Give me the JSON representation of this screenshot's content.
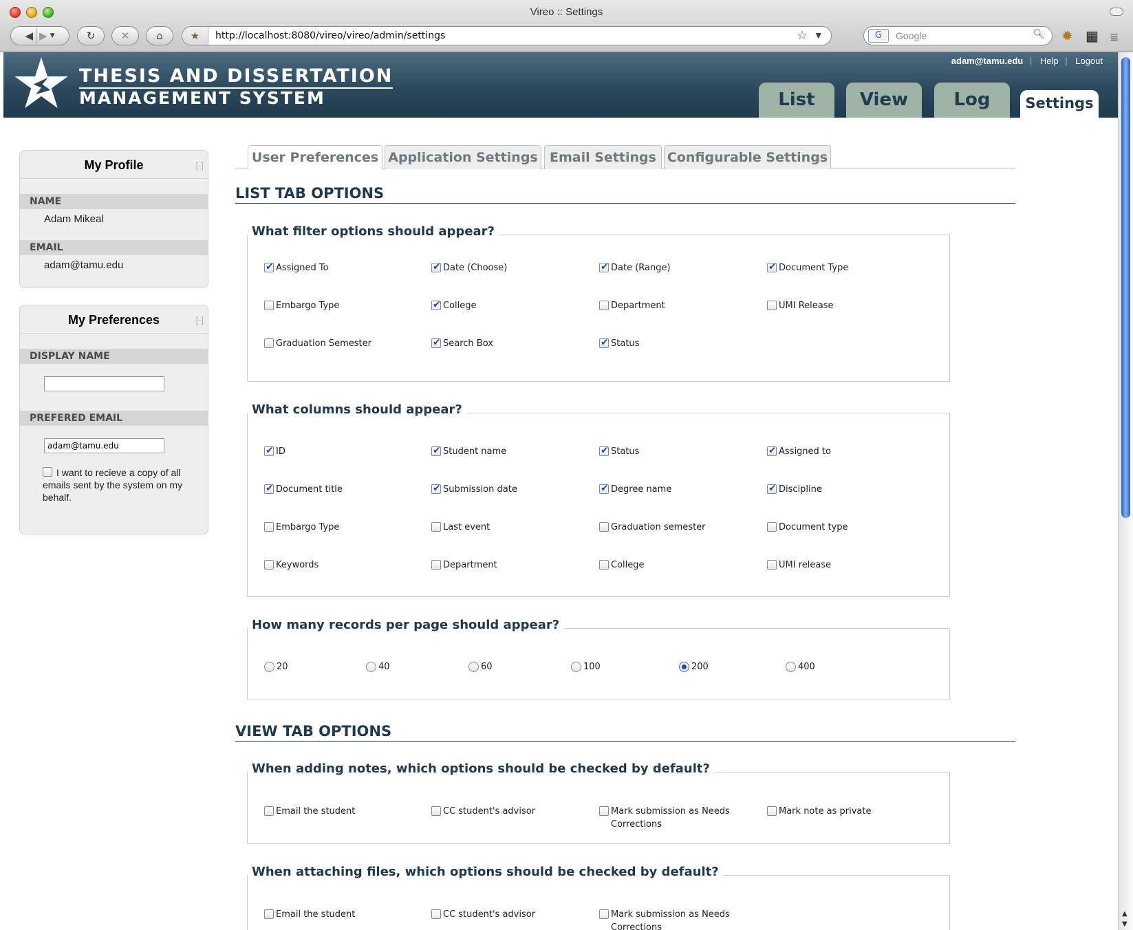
{
  "browser": {
    "window_title": "Vireo :: Settings",
    "url": "http://localhost:8080/vireo/vireo/admin/settings",
    "search_placeholder": "Google"
  },
  "header": {
    "brand_line1": "THESIS AND DISSERTATION",
    "brand_line2": "MANAGEMENT SYSTEM",
    "user": "adam@tamu.edu",
    "help": "Help",
    "logout": "Logout",
    "tabs": {
      "list": "List",
      "view": "View",
      "log": "Log",
      "settings": "Settings"
    }
  },
  "sidebar": {
    "profile": {
      "title": "My Profile",
      "toggle": "[-]",
      "name_label": "NAME",
      "name_value": "Adam Mikeal",
      "email_label": "EMAIL",
      "email_value": "adam@tamu.edu"
    },
    "preferences": {
      "title": "My Preferences",
      "toggle": "[-]",
      "display_name_label": "DISPLAY NAME",
      "display_name_value": "",
      "preferred_email_label": "PREFERED EMAIL",
      "preferred_email_value": "adam@tamu.edu",
      "copy_emails_label": "I want to recieve a copy of all emails sent by the system on my behalf.",
      "copy_emails_checked": false
    }
  },
  "subtabs": [
    "User Preferences",
    "Application Settings",
    "Email Settings",
    "Configurable Settings"
  ],
  "list_tab": {
    "title": "LIST TAB OPTIONS",
    "filters": {
      "legend": "What filter options should appear?",
      "options": [
        {
          "label": "Assigned To",
          "checked": true
        },
        {
          "label": "Date (Choose)",
          "checked": true
        },
        {
          "label": "Date (Range)",
          "checked": true
        },
        {
          "label": "Document Type",
          "checked": true
        },
        {
          "label": "Embargo Type",
          "checked": false
        },
        {
          "label": "College",
          "checked": true
        },
        {
          "label": "Department",
          "checked": false
        },
        {
          "label": "UMI Release",
          "checked": false
        },
        {
          "label": "Graduation Semester",
          "checked": false
        },
        {
          "label": "Search Box",
          "checked": true
        },
        {
          "label": "Status",
          "checked": true
        }
      ]
    },
    "columns": {
      "legend": "What columns should appear?",
      "options": [
        {
          "label": "ID",
          "checked": true
        },
        {
          "label": "Student name",
          "checked": true
        },
        {
          "label": "Status",
          "checked": true
        },
        {
          "label": "Assigned to",
          "checked": true
        },
        {
          "label": "Document title",
          "checked": true
        },
        {
          "label": "Submission date",
          "checked": true
        },
        {
          "label": "Degree name",
          "checked": true
        },
        {
          "label": "Discipline",
          "checked": true
        },
        {
          "label": "Embargo Type",
          "checked": false
        },
        {
          "label": "Last event",
          "checked": false
        },
        {
          "label": "Graduation semester",
          "checked": false
        },
        {
          "label": "Document type",
          "checked": false
        },
        {
          "label": "Keywords",
          "checked": false
        },
        {
          "label": "Department",
          "checked": false
        },
        {
          "label": "College",
          "checked": false
        },
        {
          "label": "UMI release",
          "checked": false
        }
      ]
    },
    "records": {
      "legend": "How many records per page should appear?",
      "options": [
        "20",
        "40",
        "60",
        "100",
        "200",
        "400"
      ],
      "selected": "200"
    }
  },
  "view_tab": {
    "title": "VIEW TAB OPTIONS",
    "notes": {
      "legend": "When adding notes, which options should be checked by default?",
      "options": [
        {
          "label": "Email the student",
          "checked": false
        },
        {
          "label": "CC student's advisor",
          "checked": false
        },
        {
          "label": "Mark submission as Needs Corrections",
          "checked": false
        },
        {
          "label": "Mark note as private",
          "checked": false
        }
      ]
    },
    "files": {
      "legend": "When attaching files, which options should be checked by default?",
      "options": [
        {
          "label": "Email the student",
          "checked": false
        },
        {
          "label": "CC student's advisor",
          "checked": false
        },
        {
          "label": "Mark submission as Needs Corrections",
          "checked": false
        }
      ]
    }
  }
}
